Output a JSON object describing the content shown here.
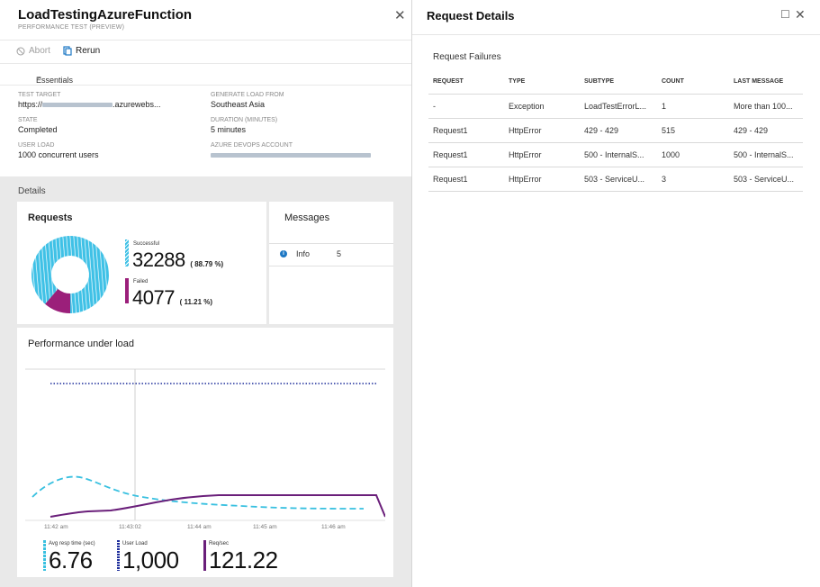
{
  "left_blade": {
    "title": "LoadTestingAzureFunction",
    "subtitle": "PERFORMANCE TEST (PREVIEW)",
    "close_icon": "close-icon",
    "commands": {
      "abort": "Abort",
      "rerun": "Rerun"
    },
    "essentials_label": "Essentials",
    "essentials": {
      "test_target_label": "TEST TARGET",
      "test_target_prefix": "https://",
      "test_target_suffix": ".azurewebs...",
      "generate_load_label": "GENERATE LOAD FROM",
      "generate_load_value": "Southeast Asia",
      "state_label": "STATE",
      "state_value": "Completed",
      "duration_label": "DURATION (MINUTES)",
      "duration_value": "5 minutes",
      "user_load_label": "USER LOAD",
      "user_load_value": "1000 concurrent users",
      "devops_label": "AZURE DEVOPS ACCOUNT"
    },
    "details_label": "Details",
    "requests_card": {
      "title": "Requests",
      "successful_label": "Successful",
      "successful_value": "32288",
      "successful_pct": "( 88.79 %)",
      "failed_label": "Failed",
      "failed_value": "4077",
      "failed_pct": "( 11.21 %)"
    },
    "messages_card": {
      "title": "Messages",
      "info_label": "Info",
      "info_count": "5"
    },
    "performance_card": {
      "title": "Performance under load",
      "x_ticks": [
        "11:42 am",
        "11:43:02",
        "11:44 am",
        "11:45 am",
        "11:46 am"
      ],
      "avg_resp_label": "Avg resp time (sec)",
      "avg_resp_value": "6.76",
      "user_load_label": "User Load",
      "user_load_value": "1,000",
      "req_sec_label": "Req/sec",
      "req_sec_value": "121.22"
    }
  },
  "right_blade": {
    "title": "Request Details",
    "subtitle": "Request Failures",
    "columns": [
      "REQUEST",
      "TYPE",
      "SUBTYPE",
      "COUNT",
      "LAST MESSAGE"
    ],
    "rows": [
      [
        "-",
        "Exception",
        "LoadTestErrorL...",
        "1",
        "More than 100..."
      ],
      [
        "Request1",
        "HttpError",
        "429 - 429",
        "515",
        "429 - 429"
      ],
      [
        "Request1",
        "HttpError",
        "500 - InternalS...",
        "1000",
        "500 - InternalS..."
      ],
      [
        "Request1",
        "HttpError",
        "503 - ServiceU...",
        "3",
        "503 - ServiceU..."
      ]
    ]
  },
  "colors": {
    "successful": "#3fc1e6",
    "failed": "#9b1f7a",
    "user_load": "#1f2f9c",
    "avg_resp": "#38c0e0",
    "req_sec": "#6a1f7a"
  },
  "chart_data": {
    "type": "line",
    "x": [
      "11:42 am",
      "11:43:02",
      "11:44 am",
      "11:45 am",
      "11:46 am"
    ],
    "series": [
      {
        "name": "User Load",
        "style": "dotted",
        "values": [
          1000,
          1000,
          1000,
          1000,
          1000
        ]
      },
      {
        "name": "Avg resp time (sec)",
        "style": "dashed",
        "values": [
          2.0,
          3.2,
          1.8,
          1.0,
          0.5
        ]
      },
      {
        "name": "Req/sec",
        "style": "solid",
        "values": [
          0.2,
          1.2,
          2.2,
          2.6,
          2.7
        ]
      }
    ],
    "grid": false,
    "donut": {
      "Successful": 88.79,
      "Failed": 11.21
    }
  }
}
